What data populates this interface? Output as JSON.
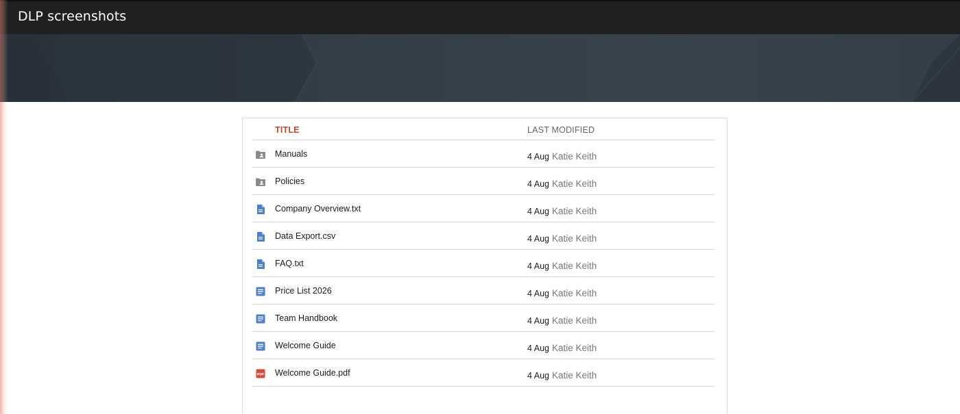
{
  "site": {
    "title": "DLP screenshots"
  },
  "colors": {
    "topbar": "#202020",
    "banner": "#333e48",
    "title_header": "#c8452a",
    "folder_icon": "#8a8a8a",
    "doc_icon": "#4a7fd6",
    "pdf_icon": "#db4a36"
  },
  "file_list": {
    "columns": {
      "title": "TITLE",
      "last_modified": "LAST MODIFIED"
    },
    "items": [
      {
        "icon": "shared-folder-icon",
        "name": "Manuals",
        "date": "4 Aug",
        "author": "Katie Keith"
      },
      {
        "icon": "shared-folder-icon",
        "name": "Policies",
        "date": "4 Aug",
        "author": "Katie Keith"
      },
      {
        "icon": "file-icon",
        "name": "Company Overview.txt",
        "date": "4 Aug",
        "author": "Katie Keith"
      },
      {
        "icon": "file-icon",
        "name": "Data Export.csv",
        "date": "4 Aug",
        "author": "Katie Keith"
      },
      {
        "icon": "file-icon",
        "name": "FAQ.txt",
        "date": "4 Aug",
        "author": "Katie Keith"
      },
      {
        "icon": "document-icon",
        "name": "Price List 2026",
        "date": "4 Aug",
        "author": "Katie Keith"
      },
      {
        "icon": "document-icon",
        "name": "Team Handbook",
        "date": "4 Aug",
        "author": "Katie Keith"
      },
      {
        "icon": "document-icon",
        "name": "Welcome Guide",
        "date": "4 Aug",
        "author": "Katie Keith"
      },
      {
        "icon": "pdf-icon",
        "name": "Welcome Guide.pdf",
        "date": "4 Aug",
        "author": "Katie Keith"
      }
    ]
  }
}
